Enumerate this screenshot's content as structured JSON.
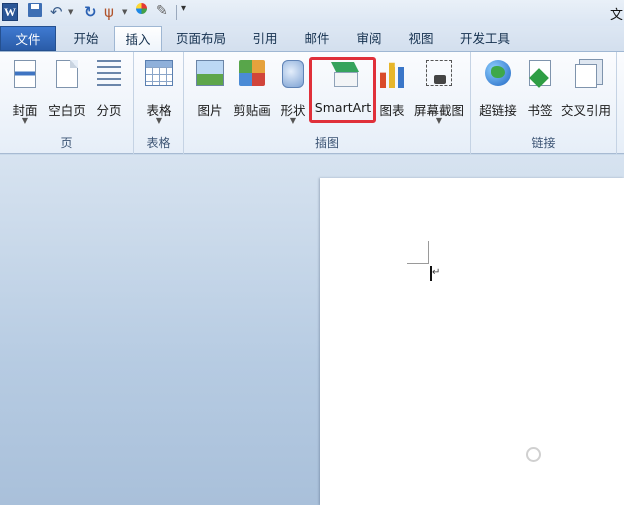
{
  "window": {
    "title_fragment": "文"
  },
  "quick_access": {
    "app_logo": "W",
    "icons": [
      "word-icon",
      "save-icon",
      "undo-icon",
      "redo-icon",
      "format-painter-icon",
      "color-icon",
      "pen-icon",
      "customize-dropdown-icon"
    ]
  },
  "tabs": [
    {
      "label": "文件"
    },
    {
      "label": "开始"
    },
    {
      "label": "插入"
    },
    {
      "label": "页面布局"
    },
    {
      "label": "引用"
    },
    {
      "label": "邮件"
    },
    {
      "label": "审阅"
    },
    {
      "label": "视图"
    },
    {
      "label": "开发工具"
    }
  ],
  "active_tab": "插入",
  "ribbon": {
    "groups": [
      {
        "label": "页",
        "buttons": [
          {
            "label": "封面"
          },
          {
            "label": "空白页"
          },
          {
            "label": "分页"
          }
        ]
      },
      {
        "label": "表格",
        "buttons": [
          {
            "label": "表格"
          }
        ]
      },
      {
        "label": "插图",
        "buttons": [
          {
            "label": "图片"
          },
          {
            "label": "剪贴画"
          },
          {
            "label": "形状"
          },
          {
            "label": "SmartArt"
          },
          {
            "label": "图表"
          },
          {
            "label": "屏幕截图"
          }
        ]
      },
      {
        "label": "链接",
        "buttons": [
          {
            "label": "超链接"
          },
          {
            "label": "书签"
          },
          {
            "label": "交叉引用"
          }
        ]
      }
    ]
  },
  "highlight": {
    "target": "SmartArt",
    "color": "#e0303a"
  },
  "colors": {
    "file_tab": "#2a5ca8",
    "ribbon_bg": "#e6eef8",
    "workspace": "#b6cbe2"
  }
}
